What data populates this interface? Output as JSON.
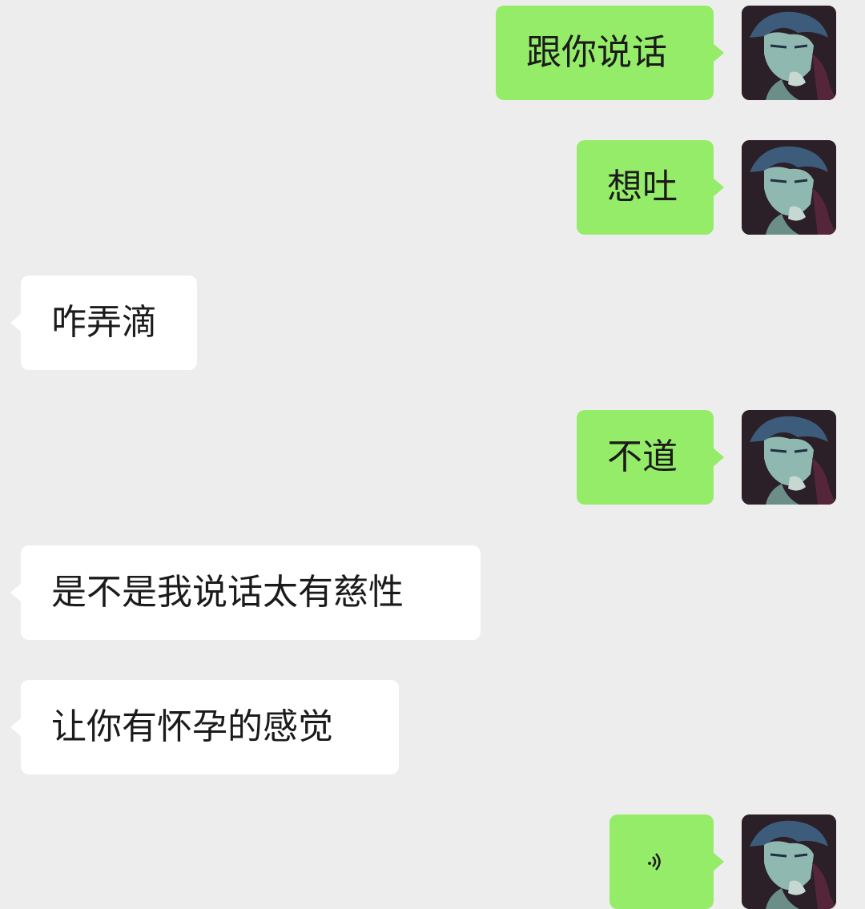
{
  "messages": [
    {
      "side": "me",
      "text": "跟你说话"
    },
    {
      "side": "me",
      "text": "想吐"
    },
    {
      "side": "other",
      "text": "咋弄滴"
    },
    {
      "side": "me",
      "text": "不道"
    },
    {
      "side": "other",
      "text": "是不是我说话太有慈性"
    },
    {
      "side": "other",
      "text": "让你有怀孕的感觉"
    },
    {
      "side": "me",
      "text": "",
      "type": "voice"
    }
  ],
  "colors": {
    "background": "#ededed",
    "my_bubble": "#95ec69",
    "other_bubble": "#ffffff",
    "text": "#1b1b1b"
  },
  "icons": {
    "avatar": "anime-man-avatar",
    "voice": "voice-wave-icon"
  }
}
